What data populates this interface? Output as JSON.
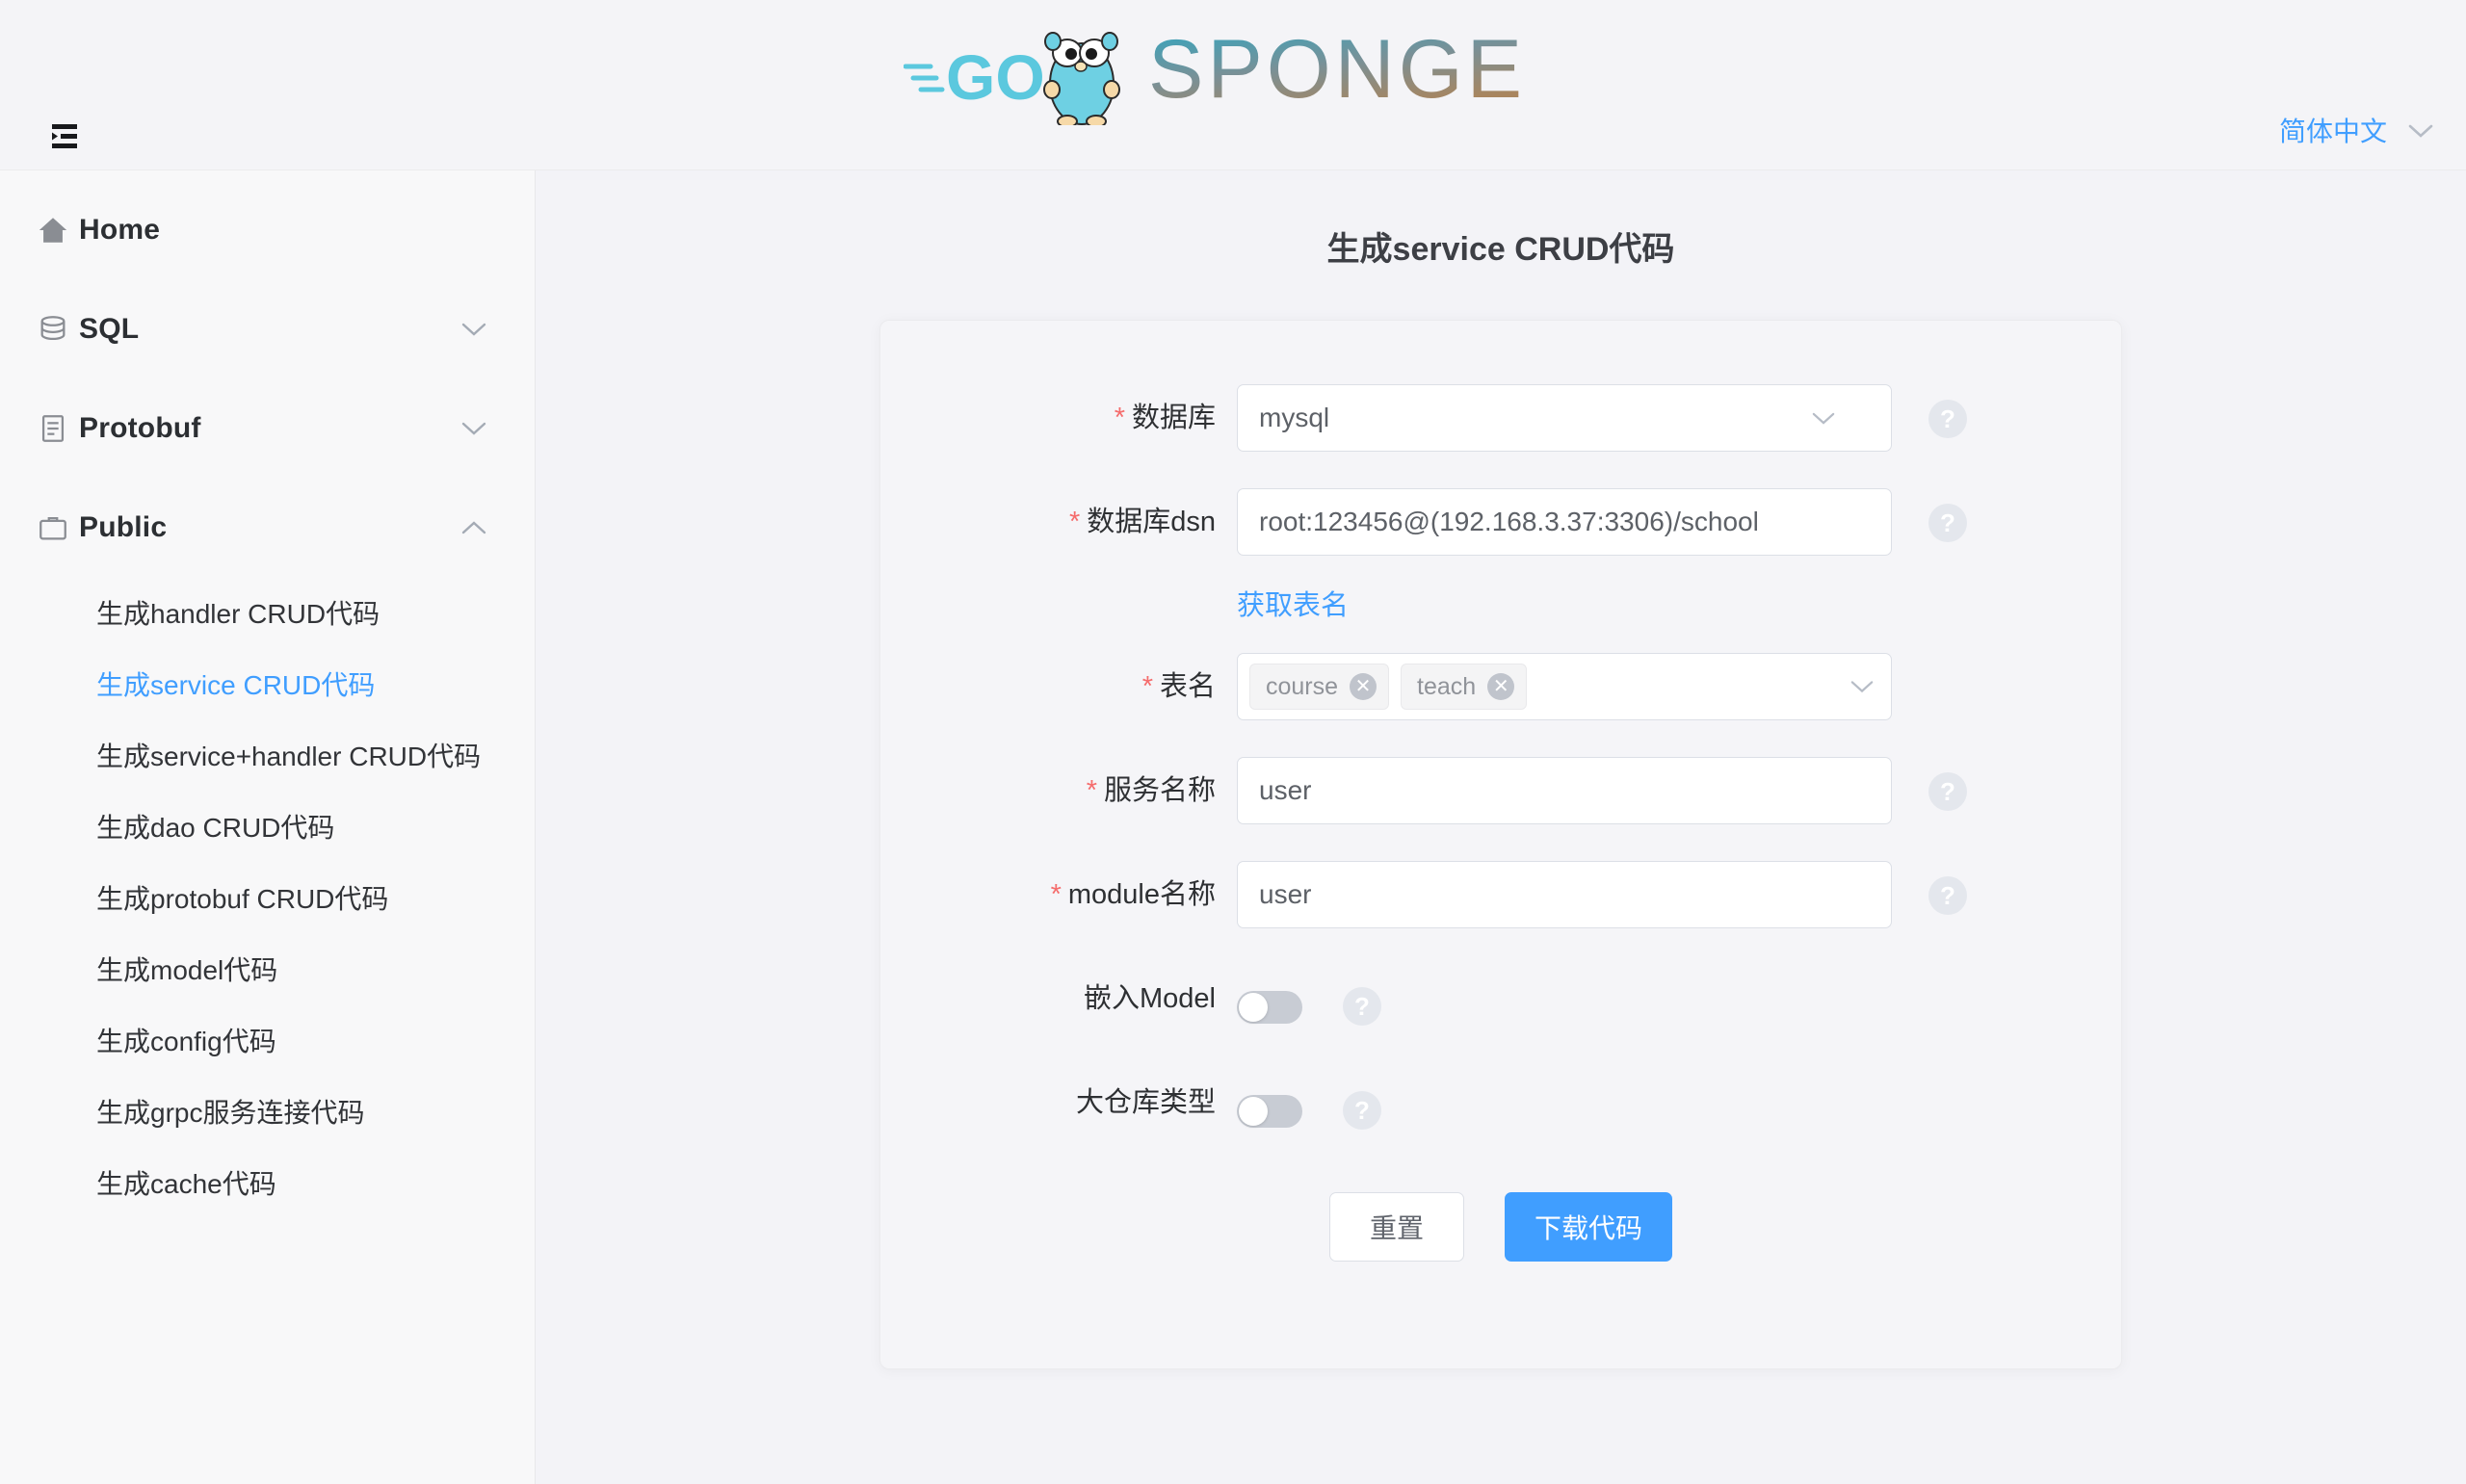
{
  "header": {
    "menu_toggle_icon": "hamburger-collapse-icon",
    "logo_text_go": "GO",
    "logo_text_sponge": "SPONGE",
    "language_label": "简体中文",
    "language_chevron_icon": "chevron-down-icon"
  },
  "sidebar": {
    "items": [
      {
        "label": "Home",
        "icon": "home-icon",
        "expandable": false,
        "arrow": ""
      },
      {
        "label": "SQL",
        "icon": "database-icon",
        "expandable": true,
        "arrow": "chevron-down-icon"
      },
      {
        "label": "Protobuf",
        "icon": "document-icon",
        "expandable": true,
        "arrow": "chevron-down-icon"
      },
      {
        "label": "Public",
        "icon": "briefcase-icon",
        "expandable": true,
        "arrow": "chevron-up-icon"
      }
    ],
    "public_submenu": [
      {
        "label": "生成handler CRUD代码",
        "active": false
      },
      {
        "label": "生成service CRUD代码",
        "active": true
      },
      {
        "label": "生成service+handler CRUD代码",
        "active": false
      },
      {
        "label": "生成dao CRUD代码",
        "active": false
      },
      {
        "label": "生成protobuf CRUD代码",
        "active": false
      },
      {
        "label": "生成model代码",
        "active": false
      },
      {
        "label": "生成config代码",
        "active": false
      },
      {
        "label": "生成grpc服务连接代码",
        "active": false
      },
      {
        "label": "生成cache代码",
        "active": false
      }
    ]
  },
  "main": {
    "title": "生成service CRUD代码",
    "form": {
      "database": {
        "label": "数据库",
        "required": true,
        "value": "mysql",
        "help": "?"
      },
      "dsn": {
        "label": "数据库dsn",
        "required": true,
        "value": "root:123456@(192.168.3.37:3306)/school",
        "help": "?"
      },
      "fetch_tables_link": "获取表名",
      "tables": {
        "label": "表名",
        "required": true,
        "tags": [
          "course",
          "teach"
        ],
        "tag_close_icon": "close-icon"
      },
      "service_name": {
        "label": "服务名称",
        "required": true,
        "value": "user",
        "help": "?"
      },
      "module_name": {
        "label": "module名称",
        "required": true,
        "value": "user",
        "help": "?"
      },
      "embed_model": {
        "label": "嵌入Model",
        "required": false,
        "on": false,
        "help": "?"
      },
      "mono_repo": {
        "label": "大仓库类型",
        "required": false,
        "on": false,
        "help": "?"
      }
    },
    "buttons": {
      "reset": "重置",
      "download": "下载代码"
    }
  },
  "colors": {
    "primary": "#409eff",
    "required_asterisk": "#f56c6c",
    "page_bg": "#f3f3f7",
    "sidebar_bg": "#f8f8f9",
    "logo_cyan": "#5bc8de"
  }
}
